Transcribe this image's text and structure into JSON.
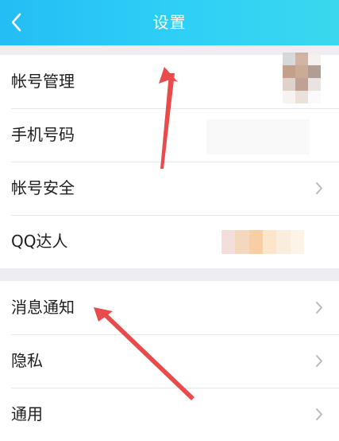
{
  "header": {
    "title": "设置"
  },
  "groups": [
    {
      "items": [
        {
          "label": "帐号管理"
        },
        {
          "label": "手机号码"
        },
        {
          "label": "帐号安全"
        },
        {
          "label": "QQ达人"
        }
      ]
    },
    {
      "items": [
        {
          "label": "消息通知"
        },
        {
          "label": "隐私"
        },
        {
          "label": "通用"
        }
      ]
    }
  ],
  "colors": {
    "header_start": "#24bdf5",
    "header_end": "#3ad7ee",
    "arrow": "#e84b4b"
  }
}
